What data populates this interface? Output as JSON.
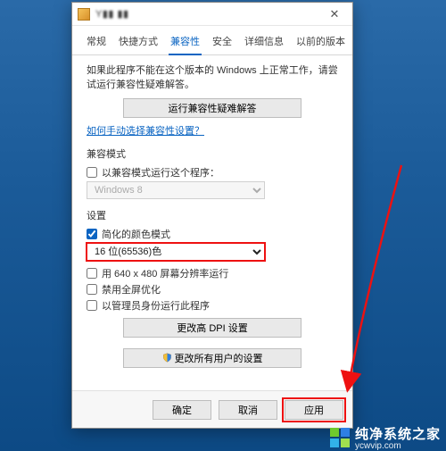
{
  "title": "Y▮▮ ▮▮",
  "tabs": [
    "常规",
    "快捷方式",
    "兼容性",
    "安全",
    "详细信息",
    "以前的版本"
  ],
  "active_tab_index": 2,
  "intro": "如果此程序不能在这个版本的 Windows 上正常工作，请尝试运行兼容性疑难解答。",
  "troubleshoot_button": "运行兼容性疑难解答",
  "link_text": "如何手动选择兼容性设置？",
  "compat_mode": {
    "title": "兼容模式",
    "checkbox_label": "以兼容模式运行这个程序：",
    "checkbox_checked": false,
    "select_value": "Windows 8"
  },
  "settings": {
    "title": "设置",
    "reduced_color": {
      "label": "简化的颜色模式",
      "checked": true
    },
    "color_select_value": "16 位(65536)色",
    "low_res": {
      "label": "用 640 x 480 屏幕分辨率运行",
      "checked": false
    },
    "disable_fullscreen": {
      "label": "禁用全屏优化",
      "checked": false
    },
    "run_as_admin": {
      "label": "以管理员身份运行此程序",
      "checked": false
    },
    "dpi_button": "更改高 DPI 设置",
    "all_users_button": "更改所有用户的设置"
  },
  "footer": {
    "ok": "确定",
    "cancel": "取消",
    "apply": "应用"
  },
  "watermark": {
    "name": "纯净系统之家",
    "url": "ycwvip.com"
  }
}
